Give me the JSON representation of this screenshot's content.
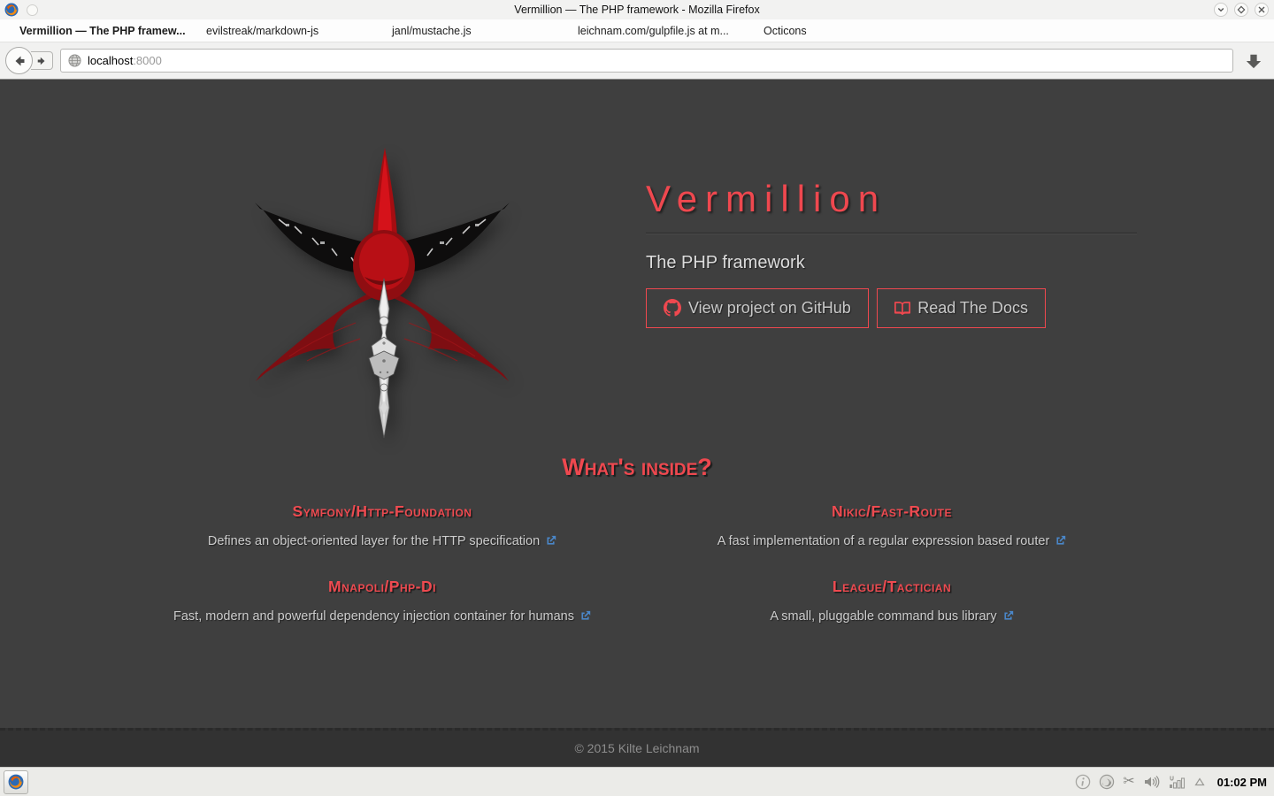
{
  "window": {
    "title": "Vermillion — The PHP framework - Mozilla Firefox"
  },
  "tabs": [
    {
      "label": "Vermillion — The PHP framew...",
      "active": true
    },
    {
      "label": "evilstreak/markdown-js",
      "active": false
    },
    {
      "label": "janl/mustache.js",
      "active": false
    },
    {
      "label": "leichnam.com/gulpfile.js at m...",
      "active": false
    },
    {
      "label": "Octicons",
      "active": false
    }
  ],
  "navbar": {
    "url_host": "localhost",
    "url_port": ":8000"
  },
  "page": {
    "title": "Vermillion",
    "subtitle": "The PHP framework",
    "github_button": "View project on GitHub",
    "docs_button": "Read The Docs",
    "section_heading": "What's inside?",
    "packages": [
      {
        "name": "Symfony/Http-Foundation",
        "description": "Defines an object-oriented layer for the HTTP specification"
      },
      {
        "name": "Nikic/Fast-Route",
        "description": "A fast implementation of a regular expression based router"
      },
      {
        "name": "Mnapoli/Php-Di",
        "description": "Fast, modern and powerful dependency injection container for humans"
      },
      {
        "name": "League/Tactician",
        "description": "A small, pluggable command bus library"
      }
    ],
    "footer": "© 2015 Kilte Leichnam"
  },
  "taskbar": {
    "clock": "01:02 PM"
  },
  "icons": {
    "scissors": "✂"
  },
  "colors": {
    "accent_red": "#ef484f",
    "link_blue": "#4a86c8",
    "content_bg": "#3f3f3f",
    "footer_bg": "#323232"
  }
}
